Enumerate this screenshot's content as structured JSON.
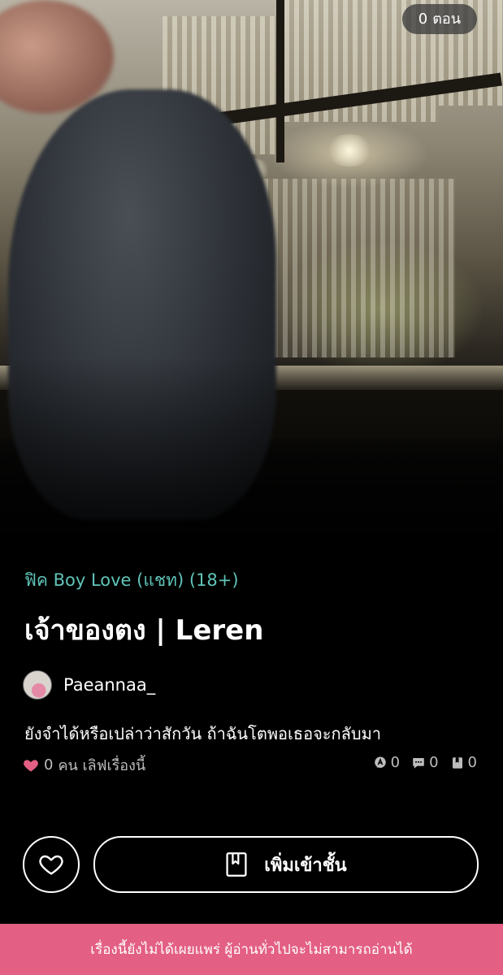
{
  "cover": {
    "episode_count": "0",
    "episode_unit": "ตอน"
  },
  "story": {
    "genre": "ฟิค Boy Love (แชท) (18+)",
    "title": "เจ้าของตง | Leren",
    "author": "Paeannaa_",
    "tagline": "ยังจำได้หรือเปล่าว่าสักวัน ถ้าฉันโตพอเธอจะกลับมา",
    "love_count": "0",
    "love_label": "คน เลิฟเรื่องนี้"
  },
  "stats": {
    "reviews": "0",
    "comments": "0",
    "saves": "0"
  },
  "actions": {
    "add_to_shelf_label": "เพิ่มเข้าชั้น"
  },
  "notice": {
    "text": "เรื่องนี้ยังไม่ได้เผยแพร่ ผู้อ่านทั่วไปจะไม่สามารถอ่านได้"
  },
  "colors": {
    "genre": "#5fc4b8",
    "heart": "#e35f83",
    "notice_bg": "#e35f83"
  },
  "icons": [
    "heart-icon",
    "review-icon",
    "comment-icon",
    "bookmark-icon",
    "heart-outline-icon",
    "book-icon"
  ]
}
